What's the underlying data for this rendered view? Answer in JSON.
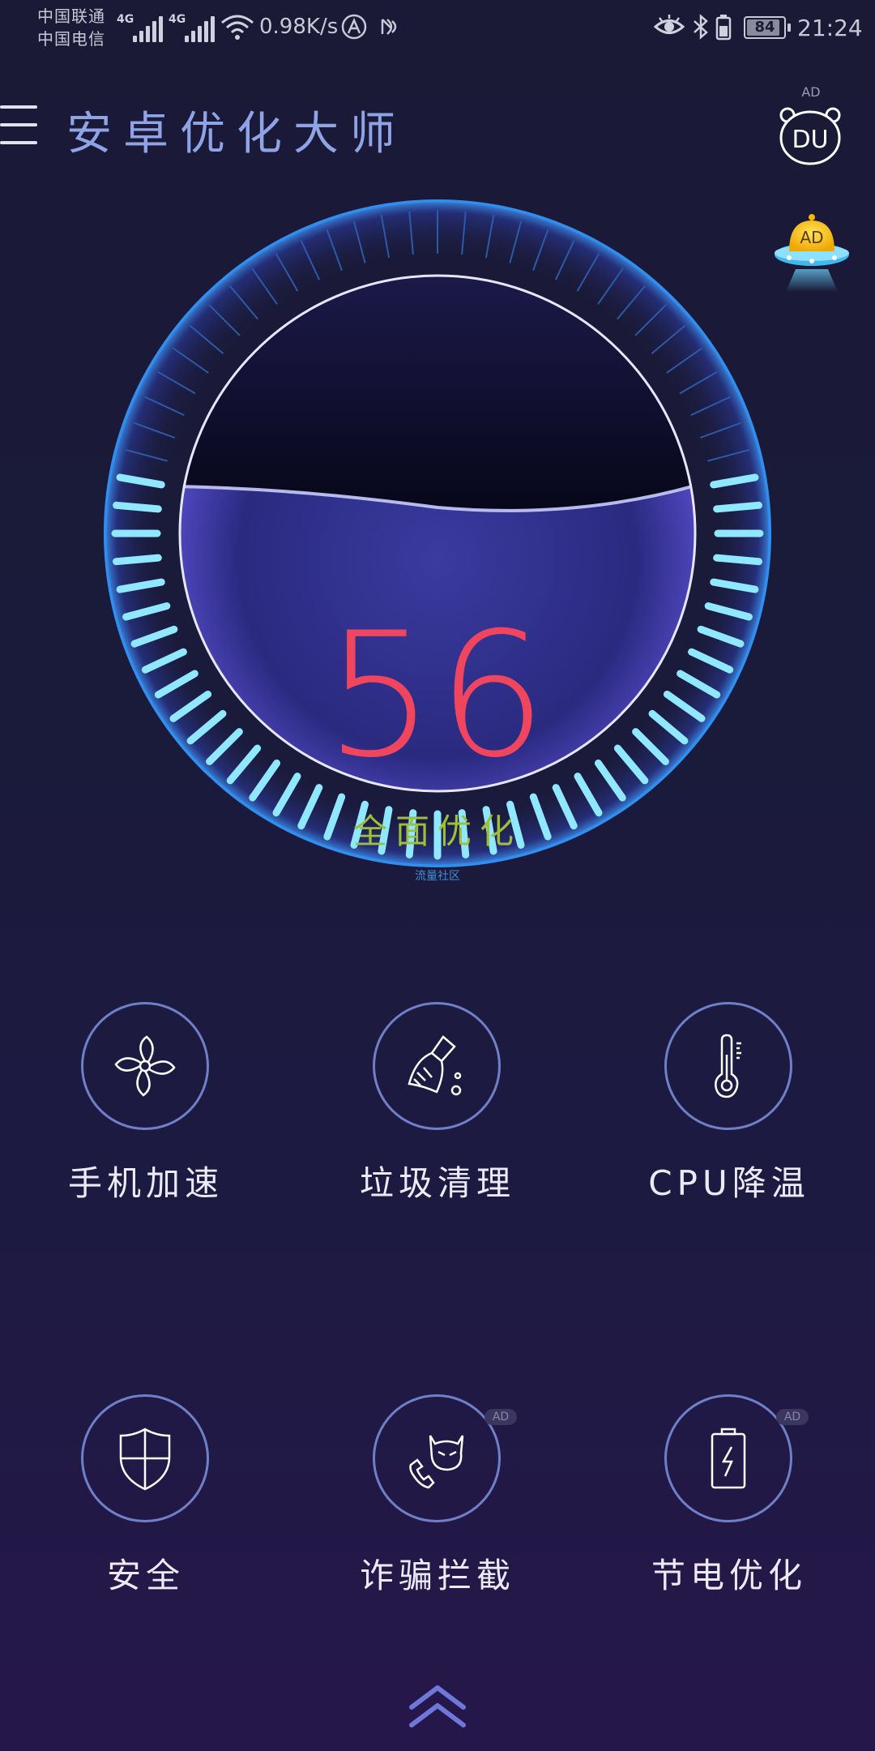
{
  "status_bar": {
    "carrier_1": "中国联通",
    "carrier_2": "中国电信",
    "network_1": "4G",
    "network_2": "4G",
    "speed": "0.98K/s",
    "battery_level": "84",
    "time": "21:24"
  },
  "header": {
    "title": "安卓优化大师",
    "du_ad_label": "AD",
    "du_text": "DU",
    "ufo_ad_label": "AD"
  },
  "gauge": {
    "score": "56",
    "action_label": "全面优化",
    "watermark": "流量社区",
    "fill_fraction": 0.56
  },
  "features": [
    {
      "label": "手机加速",
      "icon": "fan-icon",
      "ad": ""
    },
    {
      "label": "垃圾清理",
      "icon": "broom-icon",
      "ad": ""
    },
    {
      "label": "CPU降温",
      "icon": "thermometer-icon",
      "ad": ""
    },
    {
      "label": "安全",
      "icon": "shield-icon",
      "ad": ""
    },
    {
      "label": "诈骗拦截",
      "icon": "scam-call-icon",
      "ad": "AD"
    },
    {
      "label": "节电优化",
      "icon": "battery-bolt-icon",
      "ad": "AD"
    }
  ],
  "colors": {
    "score": "#f0455e",
    "action": "#9fbf3a",
    "title": "#8fa4e6",
    "accent": "#6f7fc8"
  }
}
